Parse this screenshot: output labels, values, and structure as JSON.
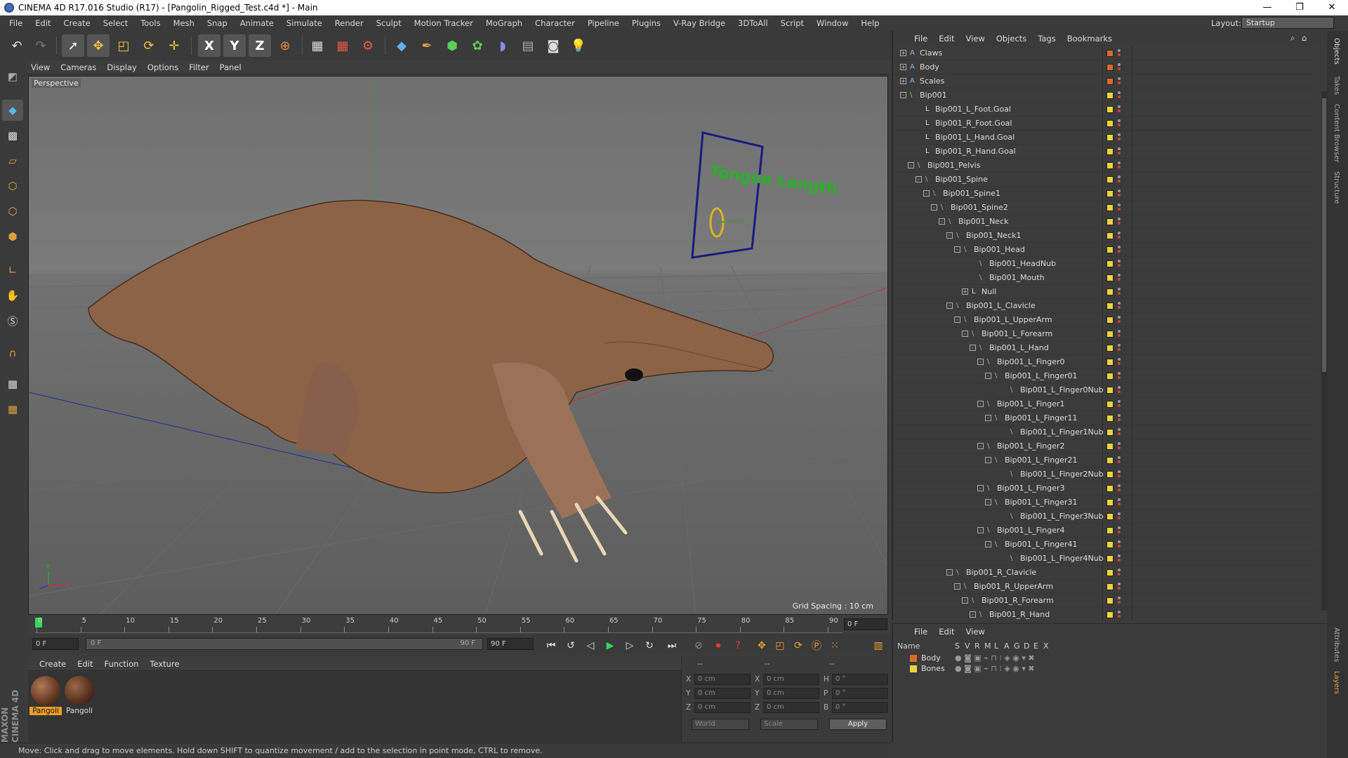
{
  "window": {
    "title": "CINEMA 4D R17.016 Studio (R17) - [Pangolin_Rigged_Test.c4d *] - Main",
    "minimize": "—",
    "maximize": "❐",
    "close": "✕"
  },
  "menu": [
    "File",
    "Edit",
    "Create",
    "Select",
    "Tools",
    "Mesh",
    "Snap",
    "Animate",
    "Simulate",
    "Render",
    "Sculpt",
    "Motion Tracker",
    "MoGraph",
    "Character",
    "Pipeline",
    "Plugins",
    "V-Ray Bridge",
    "3DToAll",
    "Script",
    "Window",
    "Help"
  ],
  "layout": {
    "label": "Layout:",
    "value": "Startup"
  },
  "toolbar_icons": [
    "undo-icon",
    "redo-icon",
    "select-arrow-icon",
    "move-icon",
    "scale-icon",
    "rotate-icon",
    "live-select-icon",
    "x-axis-icon",
    "y-axis-icon",
    "z-axis-icon",
    "world-coord-icon",
    "render-view-icon",
    "render-pv-icon",
    "render-settings-icon",
    "cube-icon",
    "pen-icon",
    "subdivision-icon",
    "cloner-icon",
    "deformer-icon",
    "floor-icon",
    "camera-icon",
    "light-icon"
  ],
  "toolbar_glyphs": {
    "x": "X",
    "y": "Y",
    "z": "Z"
  },
  "viewport": {
    "menu": [
      "View",
      "Cameras",
      "Display",
      "Options",
      "Filter",
      "Panel"
    ],
    "label": "Perspective",
    "grid_spacing": "Grid Spacing : 10 cm",
    "axis_y": "Y",
    "axis_x": "X",
    "label_text": "Tongue Length"
  },
  "timeline": {
    "ticks": [
      "0",
      "5",
      "10",
      "15",
      "20",
      "25",
      "30",
      "35",
      "40",
      "45",
      "50",
      "55",
      "60",
      "65",
      "70",
      "75",
      "80",
      "85",
      "90"
    ],
    "current_frame": "0 F"
  },
  "playback": {
    "start": "0 F",
    "range_start": "0 F",
    "range_end": "90 F",
    "end": "90 F"
  },
  "material_manager": {
    "menu": [
      "Create",
      "Edit",
      "Function",
      "Texture"
    ],
    "materials": [
      "Pangoli",
      "Pangoli"
    ]
  },
  "coordinates": {
    "headers": [
      "--",
      "--",
      "--"
    ],
    "rows": [
      {
        "a": "X",
        "av": "0 cm",
        "b": "X",
        "bv": "0 cm",
        "c": "H",
        "cv": "0 °"
      },
      {
        "a": "Y",
        "av": "0 cm",
        "b": "Y",
        "bv": "0 cm",
        "c": "P",
        "cv": "0 °"
      },
      {
        "a": "Z",
        "av": "0 cm",
        "b": "Z",
        "bv": "0 cm",
        "c": "B",
        "cv": "0 °"
      }
    ],
    "mode1": "World",
    "mode2": "Scale",
    "apply": "Apply"
  },
  "status": "Move: Click and drag to move elements. Hold down SHIFT to quantize movement / add to the selection in point mode, CTRL to remove.",
  "object_manager": {
    "menu": [
      "File",
      "Edit",
      "View",
      "Objects",
      "Tags",
      "Bookmarks"
    ],
    "objects": [
      {
        "name": "Claws",
        "depth": 0,
        "exp": "+",
        "color": "#d86a2b",
        "icon": "A"
      },
      {
        "name": "Body",
        "depth": 0,
        "exp": "+",
        "color": "#d86a2b",
        "icon": "A"
      },
      {
        "name": "Scales",
        "depth": 0,
        "exp": "+",
        "color": "#d86a2b",
        "icon": "A"
      },
      {
        "name": "Bip001",
        "depth": 0,
        "exp": "-",
        "color": "#e8d53a",
        "icon": "\\"
      },
      {
        "name": "Bip001_L_Foot.Goal",
        "depth": 2,
        "exp": "",
        "color": "#e8d53a",
        "icon": "L"
      },
      {
        "name": "Bip001_R_Foot.Goal",
        "depth": 2,
        "exp": "",
        "color": "#e8d53a",
        "icon": "L"
      },
      {
        "name": "Bip001_L_Hand.Goal",
        "depth": 2,
        "exp": "",
        "color": "#e8d53a",
        "icon": "L"
      },
      {
        "name": "Bip001_R_Hand.Goal",
        "depth": 2,
        "exp": "",
        "color": "#e8d53a",
        "icon": "L"
      },
      {
        "name": "Bip001_Pelvis",
        "depth": 1,
        "exp": "-",
        "color": "#e8d53a",
        "icon": "\\"
      },
      {
        "name": "Bip001_Spine",
        "depth": 2,
        "exp": "-",
        "color": "#e8d53a",
        "icon": "\\"
      },
      {
        "name": "Bip001_Spine1",
        "depth": 3,
        "exp": "-",
        "color": "#e8d53a",
        "icon": "\\"
      },
      {
        "name": "Bip001_Spine2",
        "depth": 4,
        "exp": "-",
        "color": "#e8d53a",
        "icon": "\\"
      },
      {
        "name": "Bip001_Neck",
        "depth": 5,
        "exp": "-",
        "color": "#e8d53a",
        "icon": "\\"
      },
      {
        "name": "Bip001_Neck1",
        "depth": 6,
        "exp": "-",
        "color": "#e8d53a",
        "icon": "\\"
      },
      {
        "name": "Bip001_Head",
        "depth": 7,
        "exp": "-",
        "color": "#e8d53a",
        "icon": "\\"
      },
      {
        "name": "Bip001_HeadNub",
        "depth": 9,
        "exp": "",
        "color": "#e8d53a",
        "icon": "\\"
      },
      {
        "name": "Bip001_Mouth",
        "depth": 9,
        "exp": "",
        "color": "#e8d53a",
        "icon": "\\"
      },
      {
        "name": "Null",
        "depth": 8,
        "exp": "+",
        "color": "#e8d53a",
        "icon": "L"
      },
      {
        "name": "Bip001_L_Clavicle",
        "depth": 6,
        "exp": "-",
        "color": "#e8d53a",
        "icon": "\\"
      },
      {
        "name": "Bip001_L_UpperArm",
        "depth": 7,
        "exp": "-",
        "color": "#e8d53a",
        "icon": "\\"
      },
      {
        "name": "Bip001_L_Forearm",
        "depth": 8,
        "exp": "-",
        "color": "#e8d53a",
        "icon": "\\"
      },
      {
        "name": "Bip001_L_Hand",
        "depth": 9,
        "exp": "-",
        "color": "#e8d53a",
        "icon": "\\"
      },
      {
        "name": "Bip001_L_Finger0",
        "depth": 10,
        "exp": "-",
        "color": "#e8d53a",
        "icon": "\\"
      },
      {
        "name": "Bip001_L_Finger01",
        "depth": 11,
        "exp": "-",
        "color": "#e8d53a",
        "icon": "\\"
      },
      {
        "name": "Bip001_L_Finger0Nub",
        "depth": 13,
        "exp": "",
        "color": "#e8d53a",
        "icon": "\\"
      },
      {
        "name": "Bip001_L_Finger1",
        "depth": 10,
        "exp": "-",
        "color": "#e8d53a",
        "icon": "\\"
      },
      {
        "name": "Bip001_L_Finger11",
        "depth": 11,
        "exp": "-",
        "color": "#e8d53a",
        "icon": "\\"
      },
      {
        "name": "Bip001_L_Finger1Nub",
        "depth": 13,
        "exp": "",
        "color": "#e8d53a",
        "icon": "\\"
      },
      {
        "name": "Bip001_L_Finger2",
        "depth": 10,
        "exp": "-",
        "color": "#e8d53a",
        "icon": "\\"
      },
      {
        "name": "Bip001_L_Finger21",
        "depth": 11,
        "exp": "-",
        "color": "#e8d53a",
        "icon": "\\"
      },
      {
        "name": "Bip001_L_Finger2Nub",
        "depth": 13,
        "exp": "",
        "color": "#e8d53a",
        "icon": "\\"
      },
      {
        "name": "Bip001_L_Finger3",
        "depth": 10,
        "exp": "-",
        "color": "#e8d53a",
        "icon": "\\"
      },
      {
        "name": "Bip001_L_Finger31",
        "depth": 11,
        "exp": "-",
        "color": "#e8d53a",
        "icon": "\\"
      },
      {
        "name": "Bip001_L_Finger3Nub",
        "depth": 13,
        "exp": "",
        "color": "#e8d53a",
        "icon": "\\"
      },
      {
        "name": "Bip001_L_Finger4",
        "depth": 10,
        "exp": "-",
        "color": "#e8d53a",
        "icon": "\\"
      },
      {
        "name": "Bip001_L_Finger41",
        "depth": 11,
        "exp": "-",
        "color": "#e8d53a",
        "icon": "\\"
      },
      {
        "name": "Bip001_L_Finger4Nub",
        "depth": 13,
        "exp": "",
        "color": "#e8d53a",
        "icon": "\\"
      },
      {
        "name": "Bip001_R_Clavicle",
        "depth": 6,
        "exp": "-",
        "color": "#e8d53a",
        "icon": "\\"
      },
      {
        "name": "Bip001_R_UpperArm",
        "depth": 7,
        "exp": "-",
        "color": "#e8d53a",
        "icon": "\\"
      },
      {
        "name": "Bip001_R_Forearm",
        "depth": 8,
        "exp": "-",
        "color": "#e8d53a",
        "icon": "\\"
      },
      {
        "name": "Bip001_R_Hand",
        "depth": 9,
        "exp": "-",
        "color": "#e8d53a",
        "icon": "\\"
      }
    ]
  },
  "layer_manager": {
    "menu": [
      "File",
      "Edit",
      "View"
    ],
    "headers": [
      "Name",
      "S",
      "V",
      "R",
      "M",
      "L",
      "A",
      "G",
      "D",
      "E",
      "X"
    ],
    "layers": [
      {
        "name": "Body",
        "color": "#d86a2b"
      },
      {
        "name": "Bones",
        "color": "#e8d53a"
      }
    ]
  },
  "side_tabs": [
    "Objects",
    "Takes",
    "Content Browser",
    "Structure",
    "Attributes",
    "Layers"
  ],
  "brand": "MAXON CINEMA 4D"
}
